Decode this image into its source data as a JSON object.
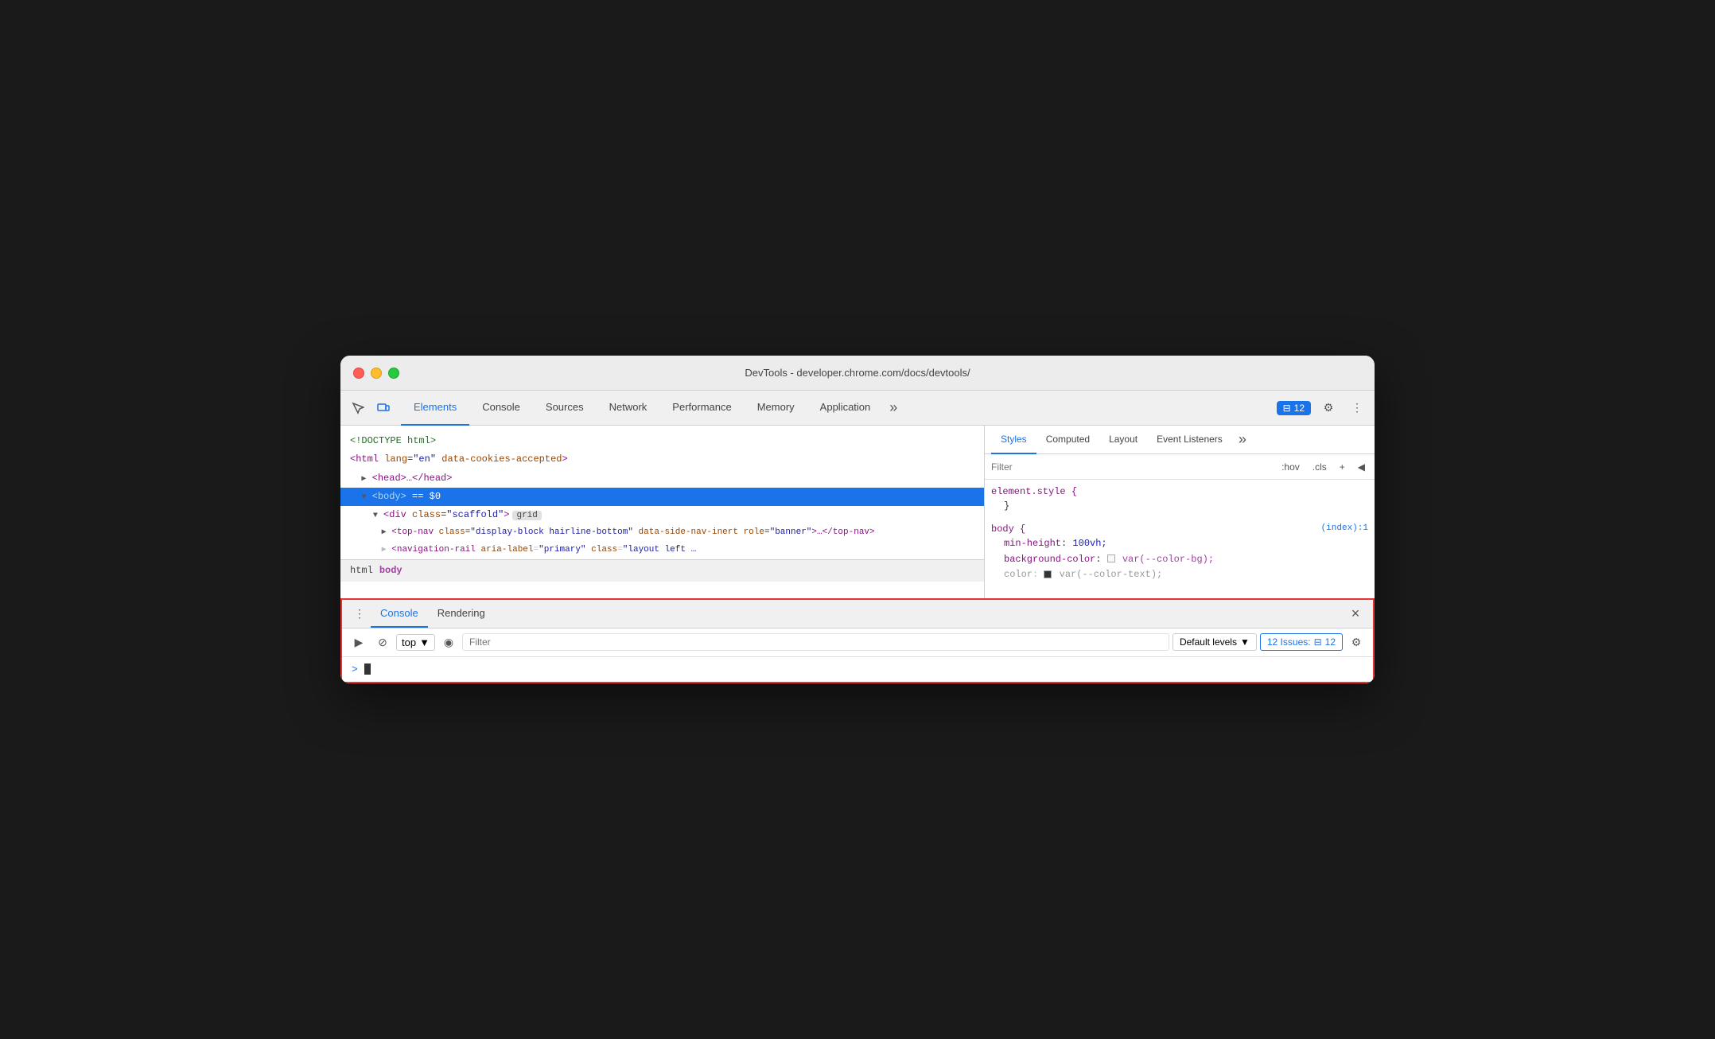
{
  "window": {
    "title": "DevTools - developer.chrome.com/docs/devtools/"
  },
  "traffic_lights": {
    "close_label": "close",
    "minimize_label": "minimize",
    "maximize_label": "maximize"
  },
  "top_tabbar": {
    "tabs": [
      {
        "label": "Elements",
        "active": true
      },
      {
        "label": "Console",
        "active": false
      },
      {
        "label": "Sources",
        "active": false
      },
      {
        "label": "Network",
        "active": false
      },
      {
        "label": "Performance",
        "active": false
      },
      {
        "label": "Memory",
        "active": false
      },
      {
        "label": "Application",
        "active": false
      }
    ],
    "more_icon": "»",
    "issues_count": "12",
    "issues_icon": "⊟"
  },
  "elements_panel": {
    "lines": [
      {
        "text": "<!DOCTYPE html>",
        "type": "comment",
        "indent": 0
      },
      {
        "text": "<html lang=\"en\" data-cookies-accepted>",
        "type": "tag",
        "indent": 0
      },
      {
        "text": "▶ <head>…</head>",
        "type": "tag",
        "indent": 1
      },
      {
        "text": "▼ <body> == $0",
        "type": "tag",
        "indent": 1,
        "selected": true
      },
      {
        "text": "▼ <div class=\"scaffold\"> grid",
        "type": "tag",
        "indent": 2
      },
      {
        "text": "▶ <top-nav class=\"display-block hairline-bottom\" data-side-nav-inert role=\"banner\">…</top-nav>",
        "type": "tag",
        "indent": 3
      },
      {
        "text": "▶ <navigation-rail aria-label=\"primary\" class=\"layout left …",
        "type": "tag",
        "indent": 3
      }
    ]
  },
  "breadcrumb": {
    "items": [
      {
        "label": "html",
        "active": false
      },
      {
        "label": "body",
        "active": true
      }
    ]
  },
  "styles_panel": {
    "tabs": [
      {
        "label": "Styles",
        "active": true
      },
      {
        "label": "Computed",
        "active": false
      },
      {
        "label": "Layout",
        "active": false
      },
      {
        "label": "Event Listeners",
        "active": false
      }
    ],
    "more_icon": "»",
    "filter_placeholder": "Filter",
    "filter_hov": ":hov",
    "filter_cls": ".cls",
    "filter_plus": "+",
    "filter_toggle": "◀",
    "rules": [
      {
        "selector": "element.style {",
        "source": "",
        "properties": [
          {
            "name": "",
            "value": "}"
          }
        ]
      },
      {
        "selector": "body {",
        "source": "(index):1",
        "properties": [
          {
            "name": "min-height",
            "value": "100vh;"
          },
          {
            "name": "background-color",
            "value": "var(--color-bg);",
            "has_swatch": true,
            "swatch_color": "#f8f9fa"
          },
          {
            "name": "color",
            "value": "var(--color-text);",
            "has_swatch": true,
            "swatch_color": "#333"
          }
        ]
      }
    ]
  },
  "console_drawer": {
    "tabs": [
      {
        "label": "Console",
        "active": true
      },
      {
        "label": "Rendering",
        "active": false
      }
    ],
    "close_icon": "×",
    "toolbar": {
      "execute_icon": "▶",
      "ban_icon": "⊘",
      "top_selector": "top",
      "dropdown_icon": "▼",
      "eye_icon": "◉",
      "filter_placeholder": "Filter",
      "default_levels": "Default levels",
      "dropdown_arrow": "▼",
      "issues_label": "12 Issues:",
      "issues_count": "12",
      "settings_icon": "⚙"
    },
    "prompt": {
      "chevron": ">",
      "cursor": "|"
    }
  }
}
